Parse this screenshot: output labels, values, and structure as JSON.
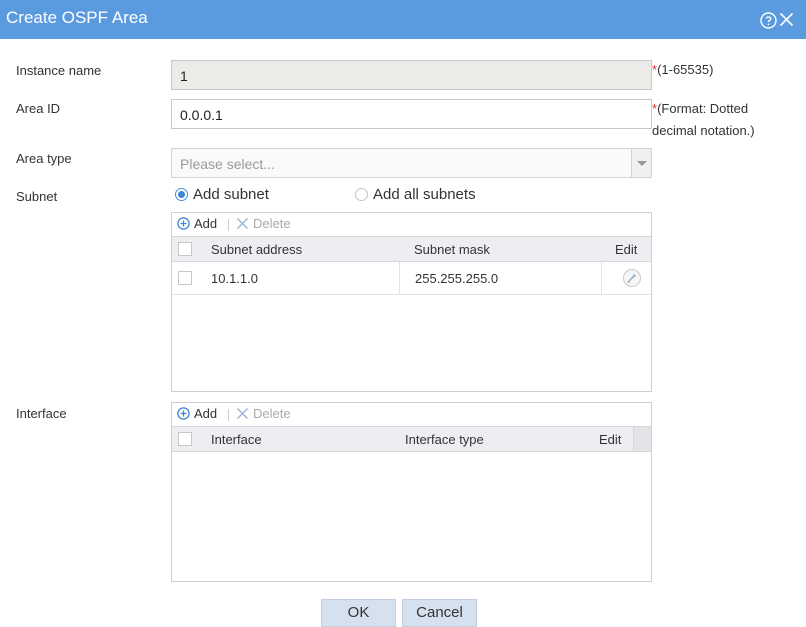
{
  "dialog": {
    "title": "Create OSPF Area"
  },
  "icons": {
    "help": "help-circle-icon",
    "close": "close-x-icon",
    "add": "plus-circle-icon",
    "delete": "x-icon",
    "edit": "pencil-icon"
  },
  "fields": {
    "instance_name": {
      "label": "Instance name",
      "value": "1",
      "required_mark": "*",
      "hint": "(1-65535)"
    },
    "area_id": {
      "label": "Area ID",
      "value": "0.0.0.1",
      "required_mark": "*",
      "hint_line1": "(Format: Dotted",
      "hint_line2": "decimal notation.)"
    },
    "area_type": {
      "label": "Area type",
      "placeholder": "Please select..."
    },
    "subnet": {
      "label": "Subnet",
      "option_add": "Add subnet",
      "option_all": "Add all subnets",
      "selected": "Add subnet"
    }
  },
  "subnet_table": {
    "add_label": "Add",
    "delete_label": "Delete",
    "columns": [
      "Subnet address",
      "Subnet mask",
      "Edit"
    ],
    "rows": [
      {
        "address": "10.1.1.0",
        "mask": "255.255.255.0"
      }
    ]
  },
  "interface_section": {
    "label": "Interface",
    "add_label": "Add",
    "delete_label": "Delete",
    "columns": [
      "Interface",
      "Interface type",
      "Edit"
    ]
  },
  "buttons": {
    "ok": "OK",
    "cancel": "Cancel"
  },
  "colors": {
    "titlebar": "#5a9be0",
    "required": "#e03030",
    "accent": "#3f85d0"
  }
}
